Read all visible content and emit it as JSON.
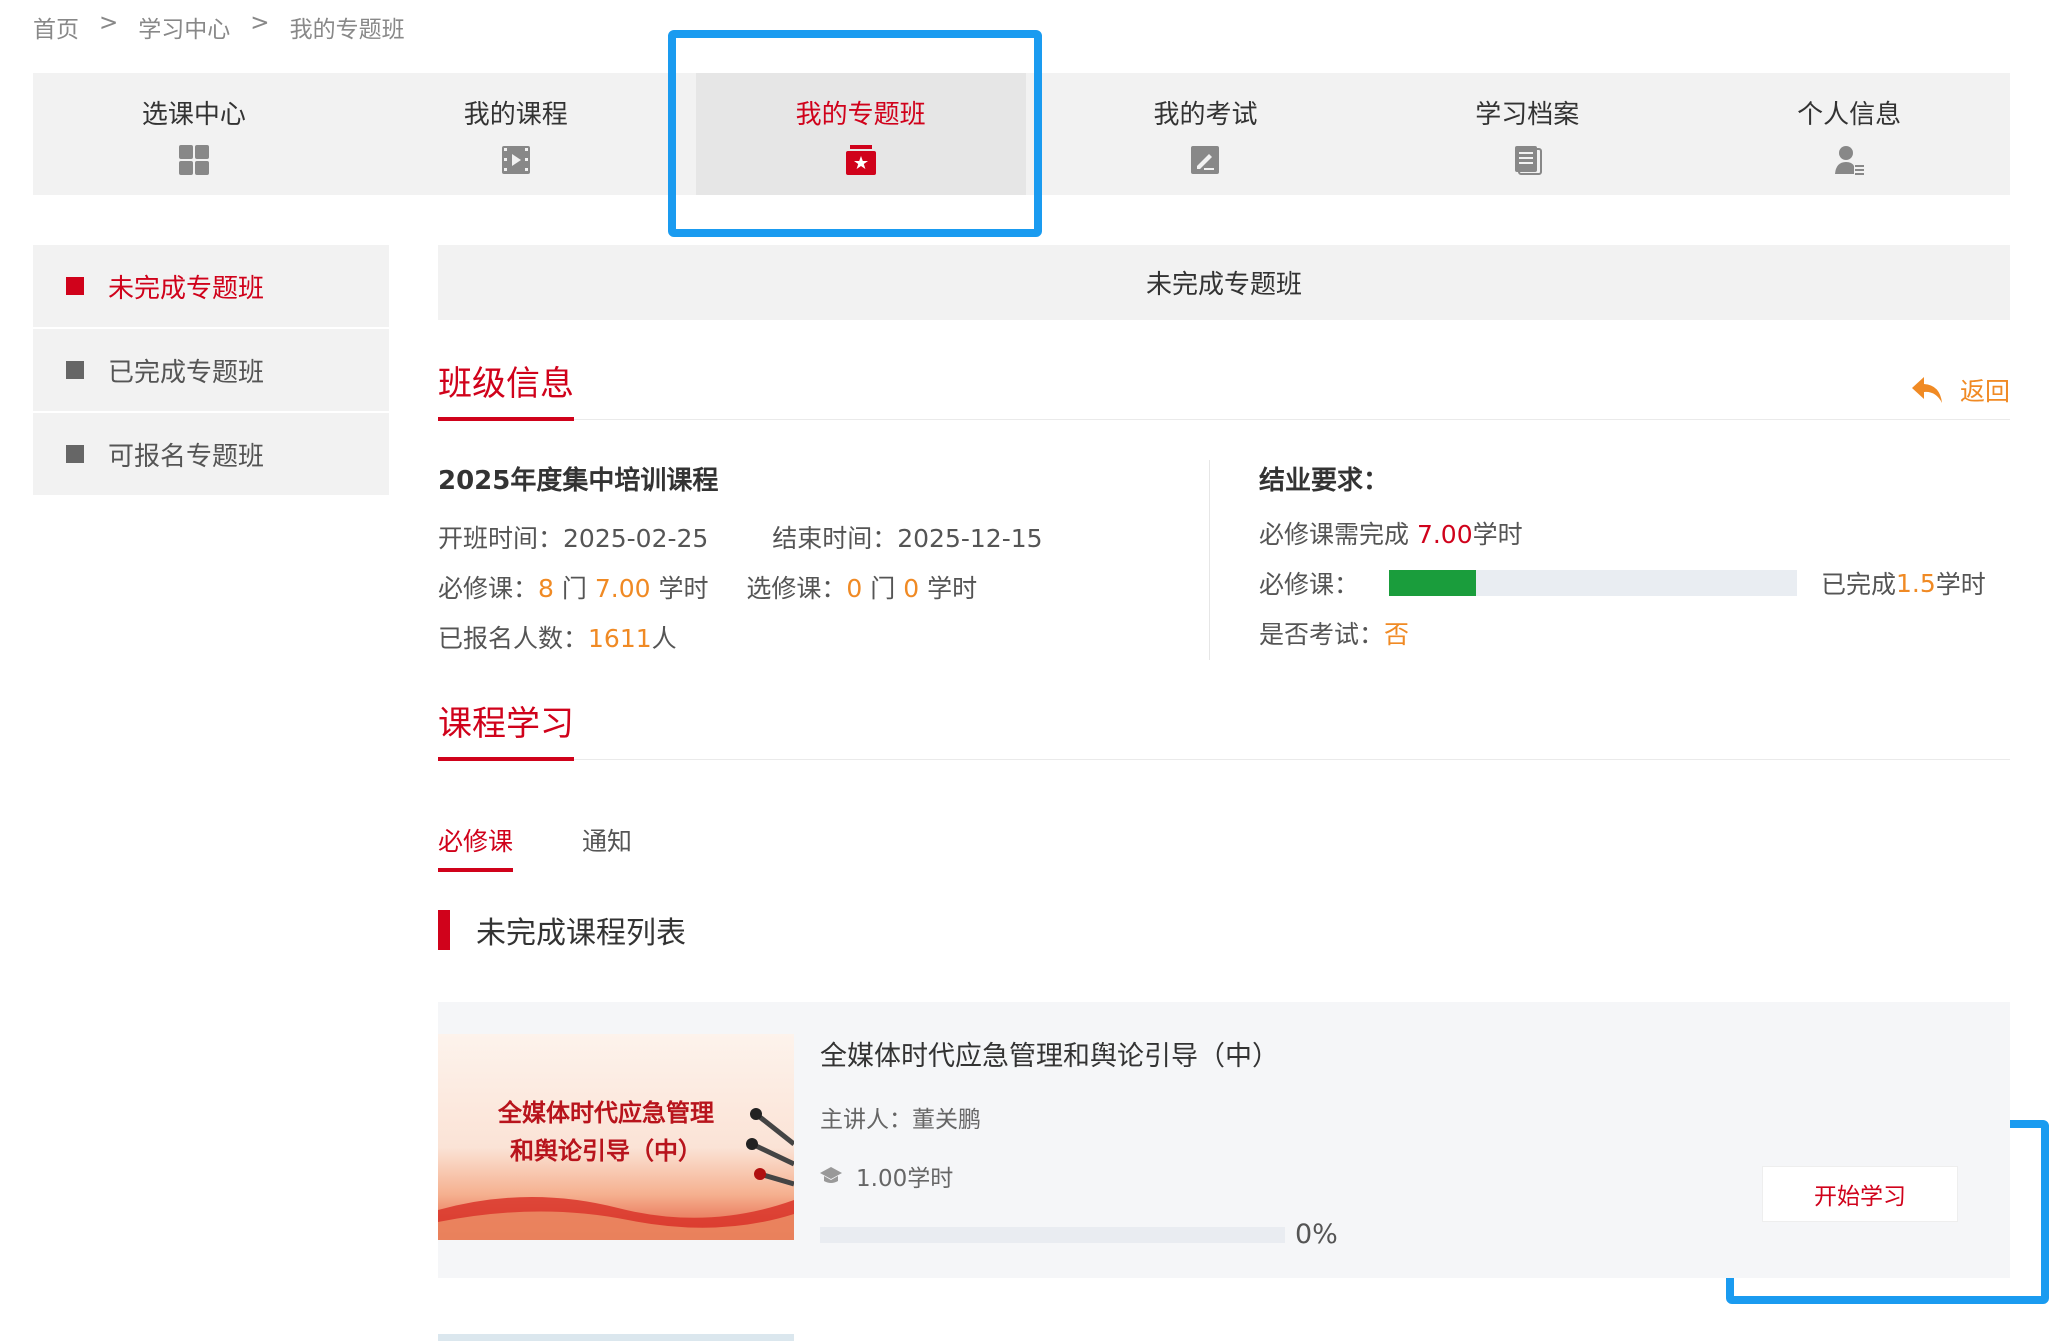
{
  "breadcrumb": [
    "首页",
    "学习中心",
    "我的专题班"
  ],
  "breadcrumb_sep": ">",
  "nav": [
    {
      "label": "选课中心",
      "icon": "grid-icon"
    },
    {
      "label": "我的课程",
      "icon": "video-icon"
    },
    {
      "label": "我的专题班",
      "icon": "class-badge-icon",
      "active": true
    },
    {
      "label": "我的考试",
      "icon": "exam-edit-icon"
    },
    {
      "label": "学习档案",
      "icon": "document-icon"
    },
    {
      "label": "个人信息",
      "icon": "user-info-icon"
    }
  ],
  "sidebar": [
    {
      "label": "未完成专题班",
      "active": true
    },
    {
      "label": "已完成专题班"
    },
    {
      "label": "可报名专题班"
    }
  ],
  "main": {
    "header": "未完成专题班",
    "class_info_title": "班级信息",
    "back_label": "返回",
    "course_name": "2025年度集中培训课程",
    "start_label": "开班时间：",
    "start_date": "2025-02-25",
    "end_label": "结束时间：",
    "end_date": "2025-12-15",
    "required_label": "必修课：",
    "required_count": "8",
    "unit_men": "门",
    "required_hours": "7.00",
    "unit_hours": "学时",
    "elective_label": "选修课：",
    "elective_count": "0",
    "elective_hours": "0",
    "enrolled_label": "已报名人数：",
    "enrolled_count": "1611",
    "unit_people": "人",
    "req_title": "结业要求：",
    "req_line_prefix": "必修课需完成 ",
    "req_hours": "7.00",
    "req_progress_label": "必修课：",
    "req_progress_fraction": 0.214,
    "completed_prefix": "已完成",
    "completed_hours": "1.5",
    "exam_label": "是否考试：",
    "exam_value": "否",
    "study_title": "课程学习",
    "tabs": [
      "必修课",
      "通知"
    ],
    "list_title": "未完成课程列表"
  },
  "course": {
    "thumb_line1": "全媒体时代应急管理",
    "thumb_line2": "和舆论引导（中）",
    "title": "全媒体时代应急管理和舆论引导（中）",
    "lecturer": "主讲人：董关鹏",
    "hours": "1.00学时",
    "progress": "0%",
    "progress_fraction": 0,
    "start_button": "开始学习"
  },
  "colors": {
    "accent_red": "#d0021b",
    "orange": "#f08a24",
    "progress_green": "#1a9d3c",
    "highlight_blue": "#1a9bf0"
  }
}
